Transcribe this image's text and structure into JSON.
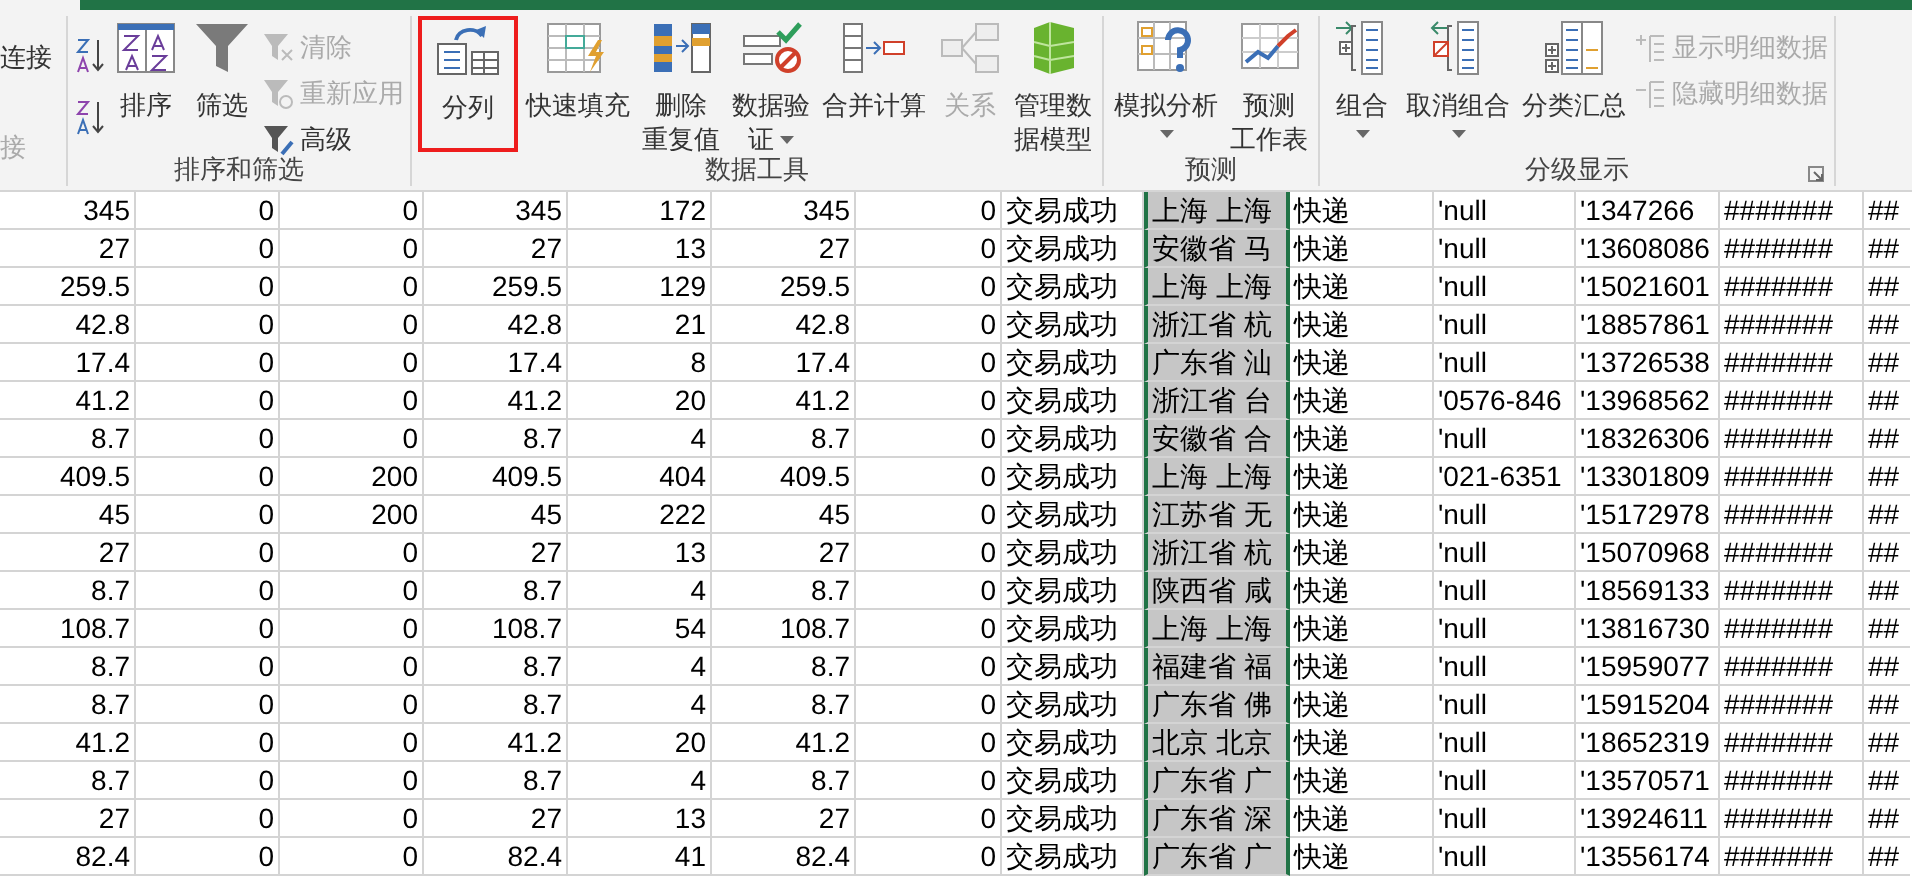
{
  "ribbon": {
    "groups": [
      {
        "columns": [
          {
            "kind": "stack",
            "items": [
              {
                "kind": "text",
                "label": "连接",
                "disabled": false
              },
              {
                "kind": "text",
                "label": "接",
                "disabled": true
              }
            ]
          }
        ]
      },
      {
        "label": "排序和筛选",
        "columns": [
          {
            "kind": "stack",
            "items": [
              {
                "kind": "icon"
              },
              {
                "kind": "icon"
              }
            ]
          },
          {
            "kind": "large",
            "label": "排序",
            "dropdown": false,
            "disabled": false,
            "highlighted": false
          },
          {
            "kind": "large",
            "label": "筛选",
            "dropdown": false,
            "disabled": false,
            "highlighted": false
          },
          {
            "kind": "stack",
            "items": [
              {
                "kind": "small",
                "label": "清除",
                "disabled": true
              },
              {
                "kind": "small",
                "label": "重新应用",
                "disabled": true
              },
              {
                "kind": "small",
                "label": "高级",
                "disabled": false
              }
            ]
          }
        ]
      },
      {
        "label": "数据工具",
        "columns": [
          {
            "kind": "large",
            "label": "分列",
            "dropdown": false,
            "disabled": false,
            "highlighted": true
          },
          {
            "kind": "large",
            "label": "快速填充",
            "dropdown": false,
            "disabled": false,
            "highlighted": false
          },
          {
            "kind": "large",
            "label": "删除重复值",
            "dropdown": false,
            "disabled": false,
            "highlighted": false
          },
          {
            "kind": "large",
            "label": "数据验证",
            "dropdown": true,
            "disabled": false,
            "highlighted": false
          },
          {
            "kind": "large",
            "label": "合并计算",
            "dropdown": false,
            "disabled": false,
            "highlighted": false
          },
          {
            "kind": "large",
            "label": "关系",
            "dropdown": false,
            "disabled": true,
            "highlighted": false
          },
          {
            "kind": "large",
            "label": "管理数据模型",
            "dropdown": false,
            "disabled": false,
            "highlighted": false
          }
        ]
      },
      {
        "label": "预测",
        "columns": [
          {
            "kind": "large",
            "label": "模拟分析",
            "dropdown": true,
            "disabled": false,
            "highlighted": false
          },
          {
            "kind": "large",
            "label": "预测工作表",
            "dropdown": false,
            "disabled": false,
            "highlighted": false
          }
        ]
      },
      {
        "label": "分级显示",
        "launcher": true,
        "columns": [
          {
            "kind": "large",
            "label": "组合",
            "dropdown": true,
            "disabled": false,
            "highlighted": false
          },
          {
            "kind": "large",
            "label": "取消组合",
            "dropdown": true,
            "disabled": false,
            "highlighted": false
          },
          {
            "kind": "large",
            "label": "分类汇总",
            "dropdown": false,
            "disabled": false,
            "highlighted": false
          },
          {
            "kind": "stack",
            "items": [
              {
                "kind": "small",
                "label": "显示明细数据",
                "disabled": true
              },
              {
                "kind": "small",
                "label": "隐藏明细数据",
                "disabled": true
              }
            ]
          }
        ]
      }
    ]
  },
  "sheet": {
    "columns": [
      {
        "kind": "number",
        "selected": false
      },
      {
        "kind": "number",
        "selected": false
      },
      {
        "kind": "number",
        "selected": false
      },
      {
        "kind": "number",
        "selected": false
      },
      {
        "kind": "number",
        "selected": false
      },
      {
        "kind": "number",
        "selected": false
      },
      {
        "kind": "number",
        "selected": false
      },
      {
        "kind": "text",
        "selected": false
      },
      {
        "kind": "text",
        "selected": true
      },
      {
        "kind": "text",
        "selected": false
      },
      {
        "kind": "text",
        "selected": false
      },
      {
        "kind": "text",
        "selected": false
      },
      {
        "kind": "text",
        "selected": false
      },
      {
        "kind": "text",
        "selected": false
      }
    ],
    "rows": [
      [
        "345",
        "0",
        "0",
        "345",
        "172",
        "345",
        "0",
        "交易成功",
        "上海 上海",
        "快递",
        "'null",
        "'1347266",
        "#######",
        "##"
      ],
      [
        "27",
        "0",
        "0",
        "27",
        "13",
        "27",
        "0",
        "交易成功",
        "安徽省 马",
        "快递",
        "'null",
        "'13608086",
        "#######",
        "##"
      ],
      [
        "259.5",
        "0",
        "0",
        "259.5",
        "129",
        "259.5",
        "0",
        "交易成功",
        "上海 上海",
        "快递",
        "'null",
        "'15021601",
        "#######",
        "##"
      ],
      [
        "42.8",
        "0",
        "0",
        "42.8",
        "21",
        "42.8",
        "0",
        "交易成功",
        "浙江省 杭",
        "快递",
        "'null",
        "'18857861",
        "#######",
        "##"
      ],
      [
        "17.4",
        "0",
        "0",
        "17.4",
        "8",
        "17.4",
        "0",
        "交易成功",
        "广东省 汕",
        "快递",
        "'null",
        "'13726538",
        "#######",
        "##"
      ],
      [
        "41.2",
        "0",
        "0",
        "41.2",
        "20",
        "41.2",
        "0",
        "交易成功",
        "浙江省 台",
        "快递",
        "'0576-846",
        "'13968562",
        "#######",
        "##"
      ],
      [
        "8.7",
        "0",
        "0",
        "8.7",
        "4",
        "8.7",
        "0",
        "交易成功",
        "安徽省 合",
        "快递",
        "'null",
        "'18326306",
        "#######",
        "##"
      ],
      [
        "409.5",
        "0",
        "200",
        "409.5",
        "404",
        "409.5",
        "0",
        "交易成功",
        "上海 上海",
        "快递",
        "'021-6351",
        "'13301809",
        "#######",
        "##"
      ],
      [
        "45",
        "0",
        "200",
        "45",
        "222",
        "45",
        "0",
        "交易成功",
        "江苏省 无",
        "快递",
        "'null",
        "'15172978",
        "#######",
        "##"
      ],
      [
        "27",
        "0",
        "0",
        "27",
        "13",
        "27",
        "0",
        "交易成功",
        "浙江省 杭",
        "快递",
        "'null",
        "'15070968",
        "#######",
        "##"
      ],
      [
        "8.7",
        "0",
        "0",
        "8.7",
        "4",
        "8.7",
        "0",
        "交易成功",
        "陕西省 咸",
        "快递",
        "'null",
        "'18569133",
        "#######",
        "##"
      ],
      [
        "108.7",
        "0",
        "0",
        "108.7",
        "54",
        "108.7",
        "0",
        "交易成功",
        "上海 上海",
        "快递",
        "'null",
        "'13816730",
        "#######",
        "##"
      ],
      [
        "8.7",
        "0",
        "0",
        "8.7",
        "4",
        "8.7",
        "0",
        "交易成功",
        "福建省 福",
        "快递",
        "'null",
        "'15959077",
        "#######",
        "##"
      ],
      [
        "8.7",
        "0",
        "0",
        "8.7",
        "4",
        "8.7",
        "0",
        "交易成功",
        "广东省 佛",
        "快递",
        "'null",
        "'15915204",
        "#######",
        "##"
      ],
      [
        "41.2",
        "0",
        "0",
        "41.2",
        "20",
        "41.2",
        "0",
        "交易成功",
        "北京 北京",
        "快递",
        "'null",
        "'18652319",
        "#######",
        "##"
      ],
      [
        "8.7",
        "0",
        "0",
        "8.7",
        "4",
        "8.7",
        "0",
        "交易成功",
        "广东省 广",
        "快递",
        "'null",
        "'13570571",
        "#######",
        "##"
      ],
      [
        "27",
        "0",
        "0",
        "27",
        "13",
        "27",
        "0",
        "交易成功",
        "广东省 深",
        "快递",
        "'null",
        "'13924611",
        "#######",
        "##"
      ],
      [
        "82.4",
        "0",
        "0",
        "82.4",
        "41",
        "82.4",
        "0",
        "交易成功",
        "广东省 广",
        "快递",
        "'null",
        "'13556174",
        "#######",
        "##"
      ]
    ]
  }
}
